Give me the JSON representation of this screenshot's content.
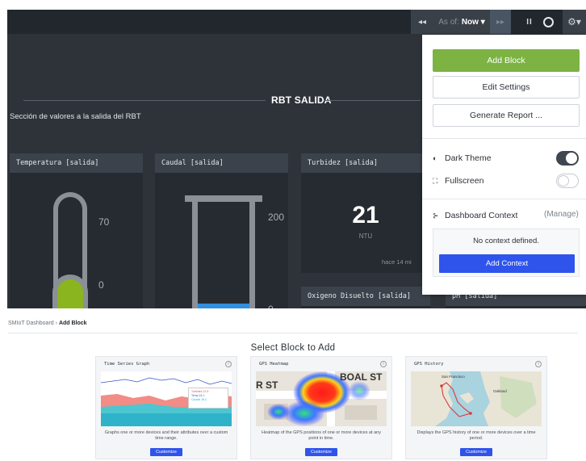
{
  "topbar": {
    "prev_glyph": "◂◂",
    "as_of_label": "As of:",
    "as_of_value": "Now ▾",
    "next_glyph": "▸▸",
    "pause_glyph": "II",
    "gear_glyph": "⚙▾"
  },
  "dashboard": {
    "section_title": "RBT SALIDA",
    "section_subtitle": "Sección de valores a la salida del RBT",
    "panels": {
      "temperatura": {
        "title": "Temperatura [salida]",
        "scale_max": "70",
        "scale_min": "0"
      },
      "caudal": {
        "title": "Caudal [salida]",
        "scale_max": "200",
        "scale_min": "0"
      },
      "turbidez": {
        "title": "Turbidez [salida]",
        "value": "21",
        "unit": "NTU",
        "time": "hace 14 mi"
      },
      "oxigeno": {
        "title": "Oxigeno Disuelto [salida]"
      },
      "ph": {
        "title": "pH [salida]"
      }
    }
  },
  "settings_menu": {
    "add_block": "Add Block",
    "edit_settings": "Edit Settings",
    "generate_report": "Generate Report ...",
    "dark_theme": {
      "label": "Dark Theme",
      "icon": "◐",
      "enabled": true
    },
    "fullscreen": {
      "label": "Fullscreen",
      "icon": "⛶",
      "enabled": false
    },
    "dashboard_context": {
      "label": "Dashboard Context",
      "icon": "⊱",
      "manage": "(Manage)"
    },
    "no_context": "No context defined.",
    "add_context": "Add Context",
    "colors": {
      "add_block_bg": "#7cb342",
      "primary": "#2f54eb"
    }
  },
  "breadcrumb": {
    "parent": "SMIoT Dashboard",
    "separator": "›",
    "current": "Add Block"
  },
  "add_block_page": {
    "title": "Select Block to Add",
    "cards": [
      {
        "title": "Time Series Graph",
        "description": "Graphs one or more devices and their attributes over a custom time range.",
        "button": "Customize",
        "legend": [
          "Turbidez 21.5",
          "Temp 24.1",
          "Caudal 18.4"
        ]
      },
      {
        "title": "GPS Heatmap",
        "description": "Heatmap of the GPS positions of one or more devices at any point in time.",
        "button": "Customize",
        "map_labels": [
          "BOAL ST",
          "R ST"
        ]
      },
      {
        "title": "GPS History",
        "description": "Displays the GPS history of one or more devices over a time period.",
        "button": "Customize",
        "map_labels": [
          "San Francisco",
          "Oakland"
        ]
      }
    ]
  }
}
